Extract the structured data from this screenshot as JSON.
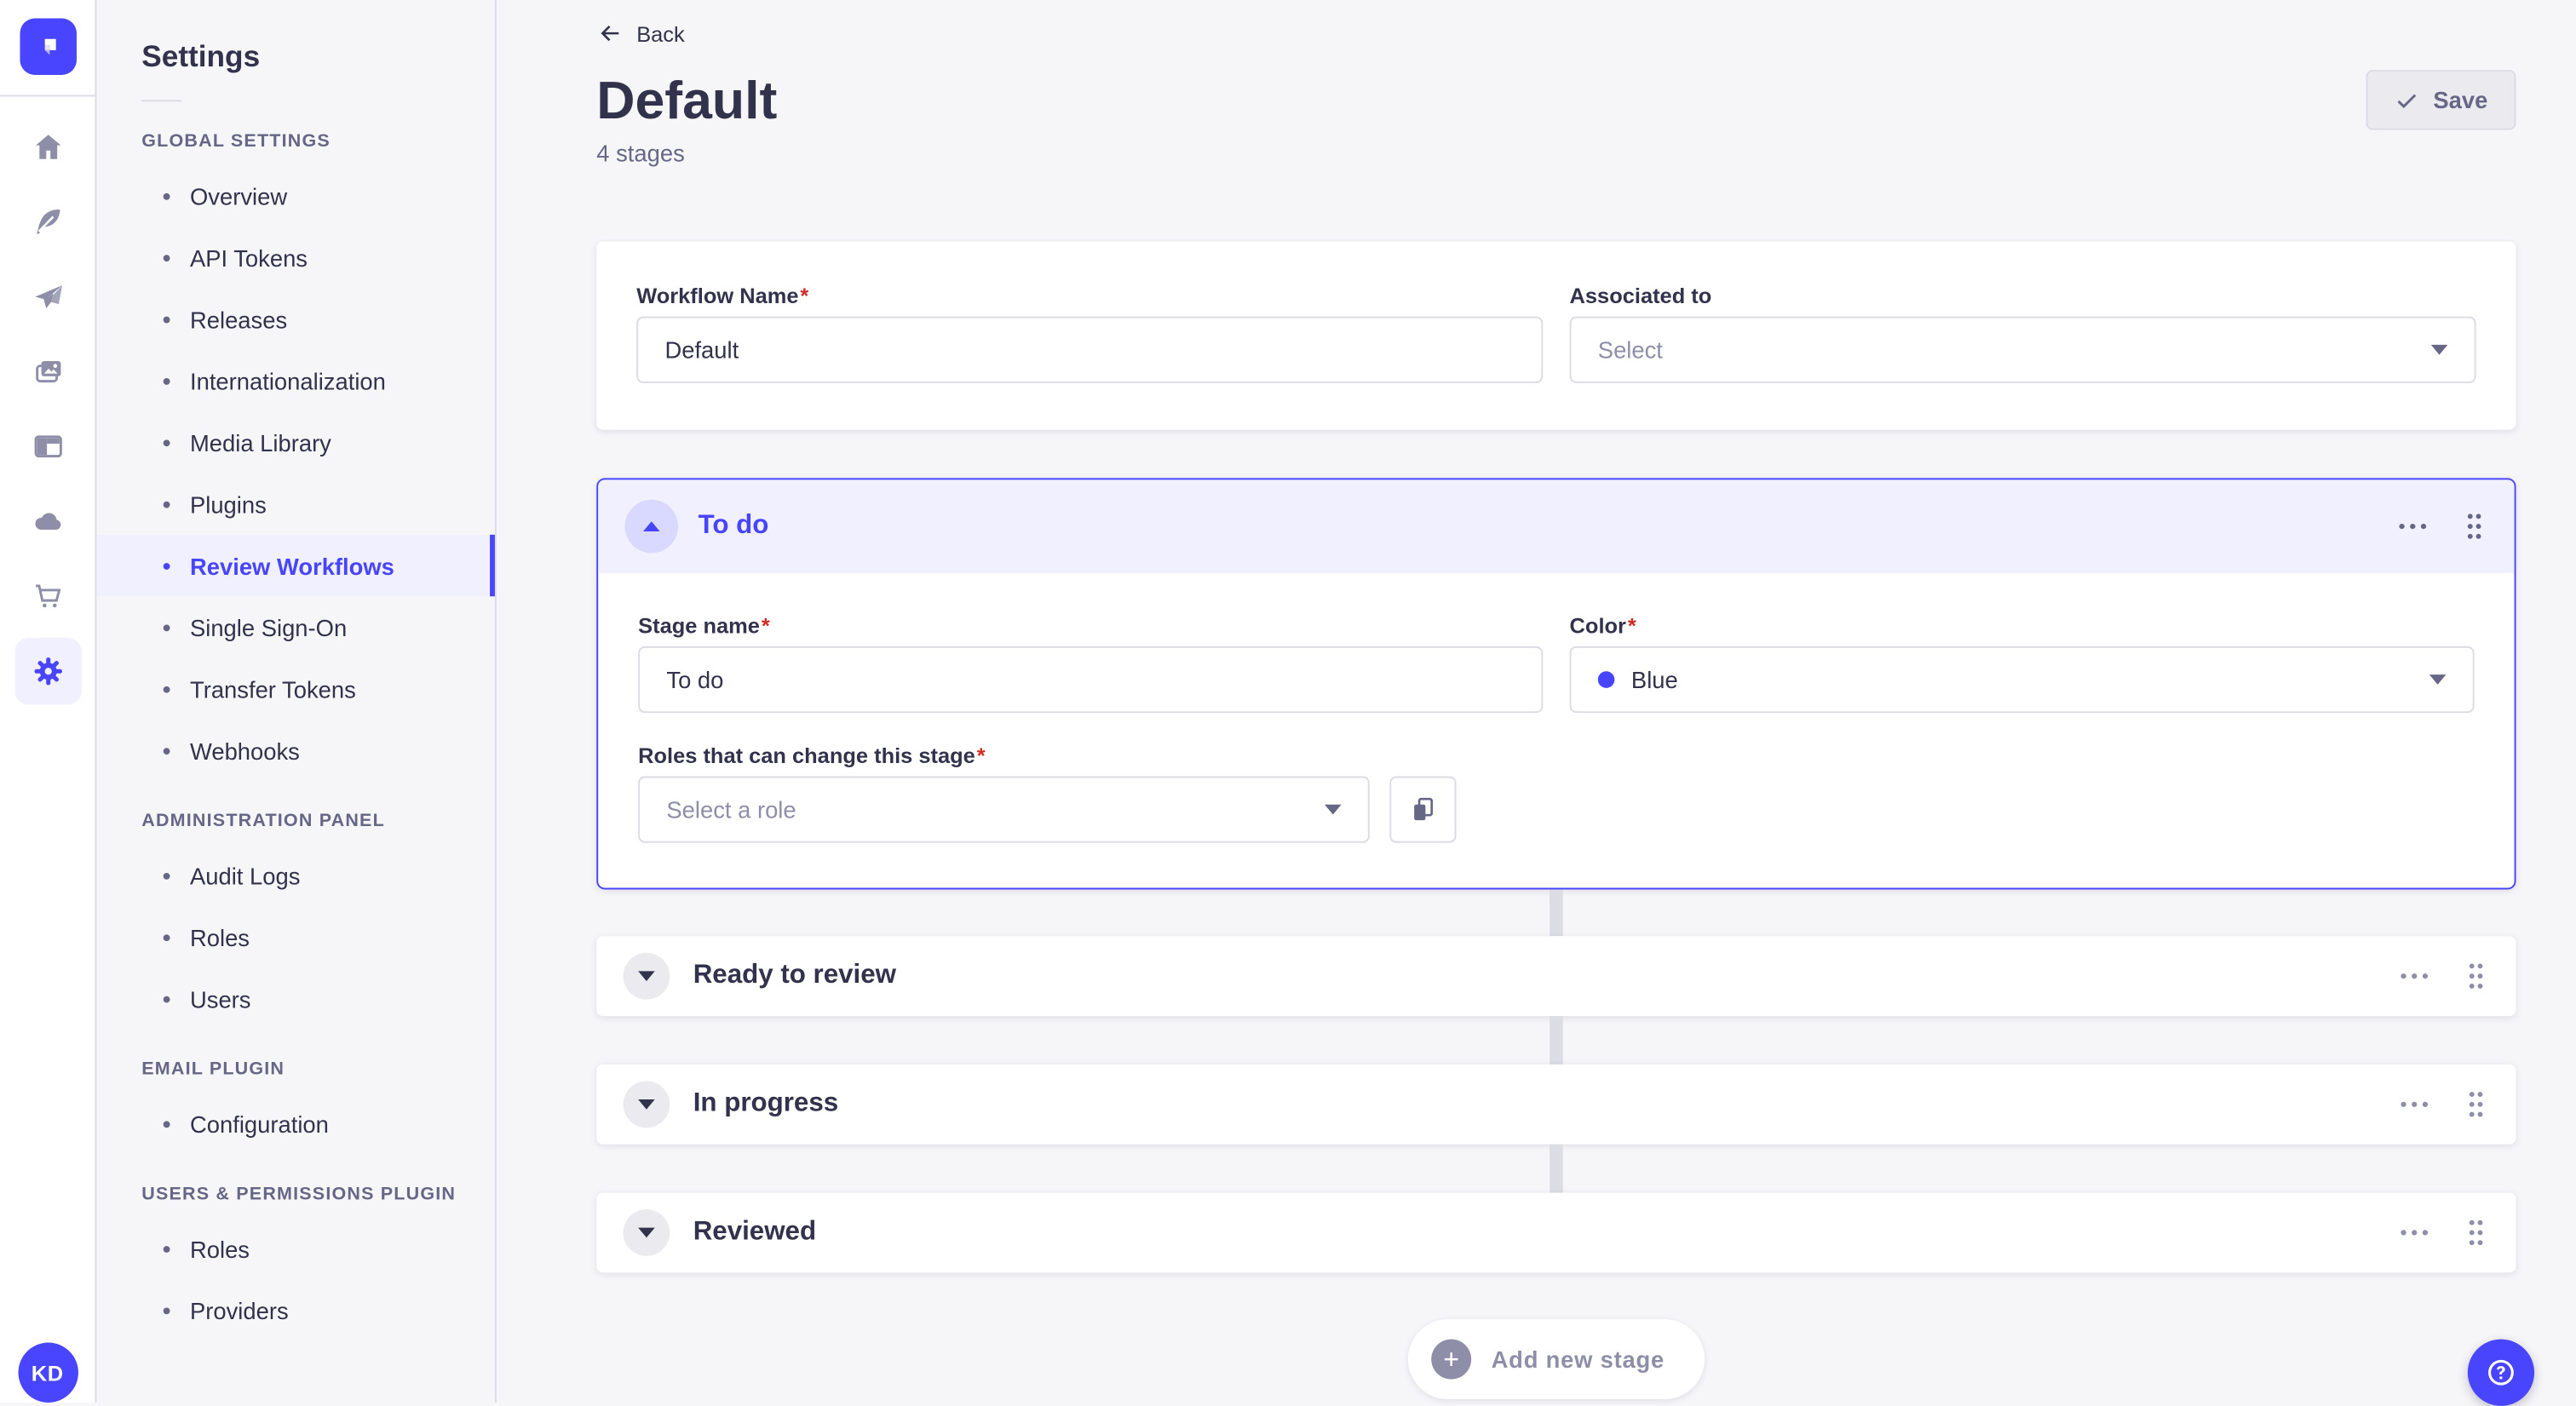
{
  "app": {
    "accent_color": "#4945FF",
    "background_color": "#F6F6F9",
    "border_color": "#DCDCE4"
  },
  "rail": {
    "logo": "strapi-logo",
    "icons": [
      "home",
      "content-manager",
      "releases",
      "media-library",
      "content-type-builder",
      "deploy",
      "marketplace",
      "settings"
    ],
    "active_icon": "settings",
    "avatar_initials": "KD"
  },
  "subnav": {
    "title": "Settings",
    "sections": [
      {
        "label": "GLOBAL SETTINGS",
        "items": [
          "Overview",
          "API Tokens",
          "Releases",
          "Internationalization",
          "Media Library",
          "Plugins",
          "Review Workflows",
          "Single Sign-On",
          "Transfer Tokens",
          "Webhooks"
        ],
        "active_item": "Review Workflows"
      },
      {
        "label": "ADMINISTRATION PANEL",
        "items": [
          "Audit Logs",
          "Roles",
          "Users"
        ]
      },
      {
        "label": "EMAIL PLUGIN",
        "items": [
          "Configuration"
        ]
      },
      {
        "label": "USERS & PERMISSIONS PLUGIN",
        "items": [
          "Roles",
          "Providers"
        ]
      }
    ]
  },
  "header": {
    "back_label": "Back",
    "title": "Default",
    "subtitle": "4 stages",
    "save_label": "Save"
  },
  "workflow_form": {
    "name_label": "Workflow Name",
    "name_value": "Default",
    "associated_label": "Associated to",
    "associated_placeholder": "Select"
  },
  "stage_expanded": {
    "title": "To do",
    "stage_name_label": "Stage name",
    "stage_name_value": "To do",
    "color_label": "Color",
    "color_value": "Blue",
    "color_hex": "#4945FF",
    "roles_label": "Roles that can change this stage",
    "roles_placeholder": "Select a role"
  },
  "stages_collapsed": [
    "Ready to review",
    "In progress",
    "Reviewed"
  ],
  "footer": {
    "add_stage_label": "Add new stage"
  },
  "misc": {
    "required_mark": "*"
  }
}
